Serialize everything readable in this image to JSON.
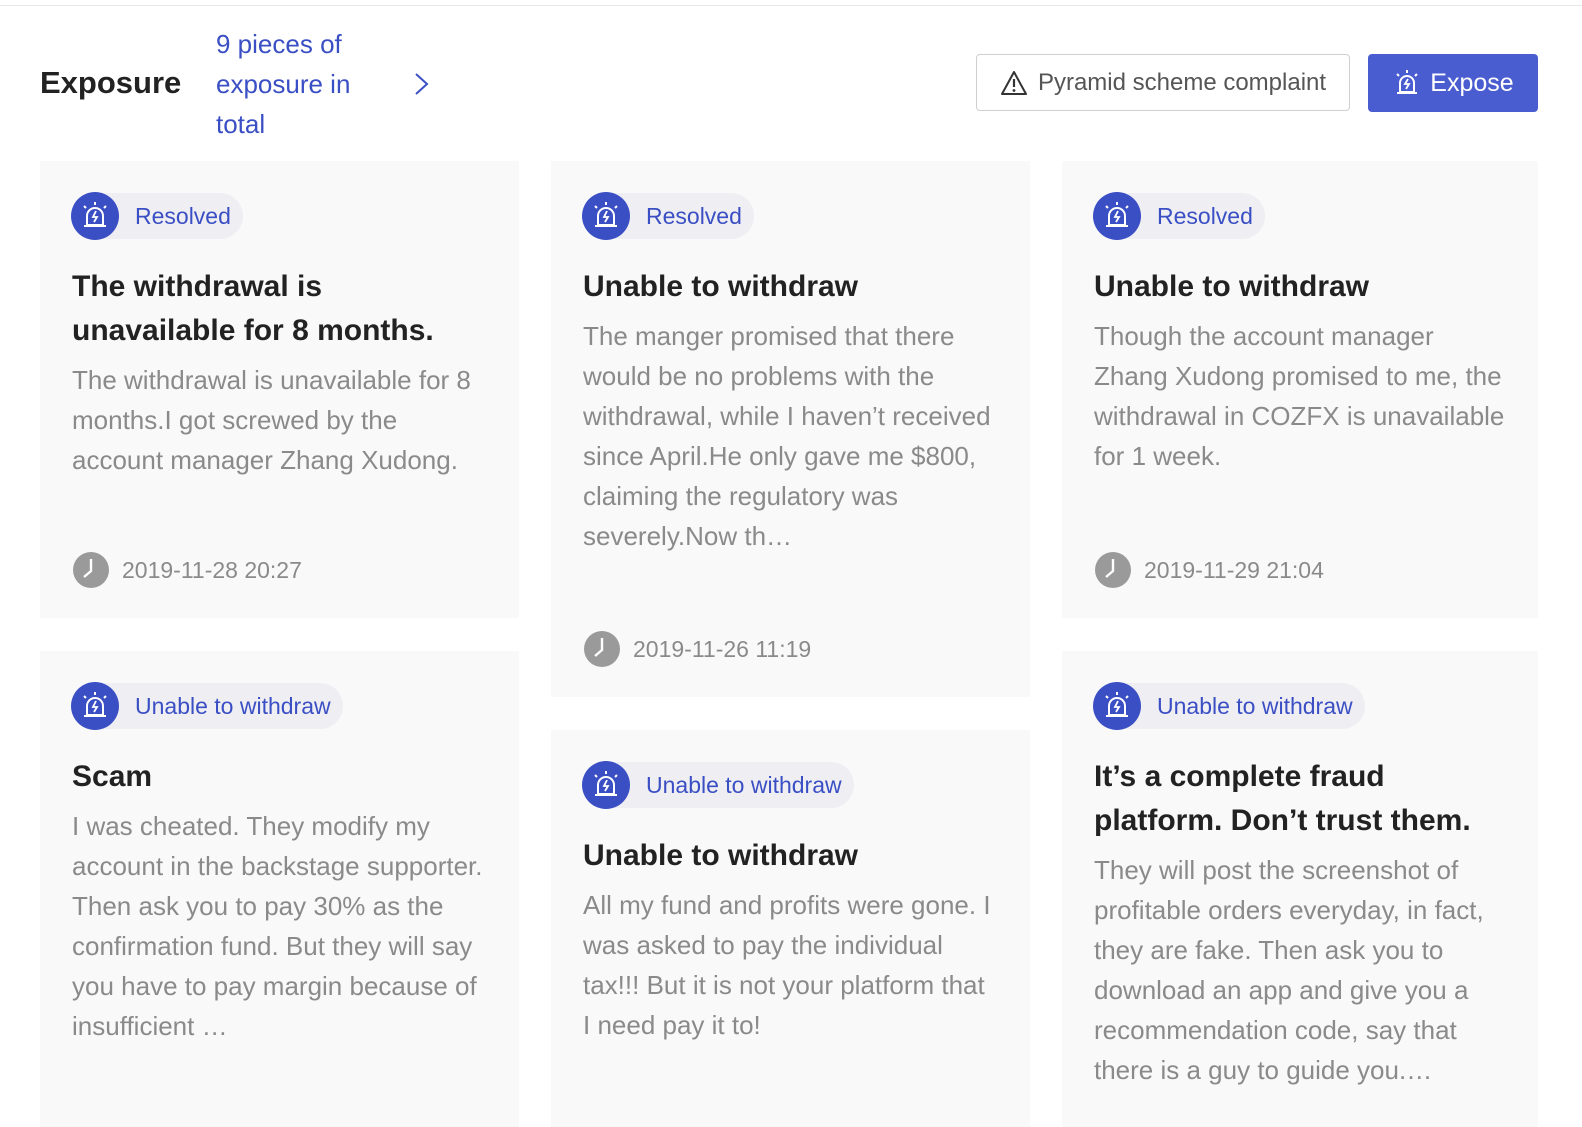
{
  "header": {
    "title": "Exposure",
    "total_link": "9 pieces of exposure in total",
    "complaint_button": "Pyramid scheme complaint",
    "expose_button": "Expose"
  },
  "cards": [
    {
      "status": "Resolved",
      "title": "The withdrawal is unavailable for 8 months.",
      "body": "The withdrawal is unavailable for 8 months.I got screwed by the account manager Zhang Xudong.",
      "date": "2019-11-28 20:27"
    },
    {
      "status": "Resolved",
      "title": "Unable to withdraw",
      "body": "The manger promised that there would be no problems with the withdrawal, while I haven’t received since April.He only gave me $800, claiming the regulatory was severely.Now th…",
      "date": "2019-11-26 11:19"
    },
    {
      "status": "Resolved",
      "title": "Unable to withdraw",
      "body": "Though the account manager Zhang Xudong promised to me, the withdrawal in COZFX is unavailable for 1 week.",
      "date": "2019-11-29 21:04"
    },
    {
      "status": "Unable to withdraw",
      "title": "Scam",
      "body": "I was cheated. They modify my account in the backstage supporter. Then ask you to pay 30% as the confirmation fund. But they will say you have to pay margin because of insufficient …"
    },
    {
      "status": "Unable to withdraw",
      "title": "Unable to withdraw",
      "body": "All my fund and profits were gone. I was asked to pay the individual tax!!! But it is not your platform that I need pay it to!"
    },
    {
      "status": "Unable to withdraw",
      "title": "It’s a complete fraud platform. Don’t trust them.",
      "body": "They will post the screenshot of profitable orders everyday, in fact, they are fake. Then ask you to download an app and give you a recommendation code, say that there is a guy to guide you.…"
    }
  ],
  "colors": {
    "accent": "#3b4fc4",
    "button": "#4a5dd0",
    "card_bg": "#f9f9f9"
  },
  "icons": {
    "badge": "alarm-siren-icon",
    "date": "clock-icon",
    "link": "chevron-right-icon",
    "complaint": "warning-triangle-icon"
  }
}
